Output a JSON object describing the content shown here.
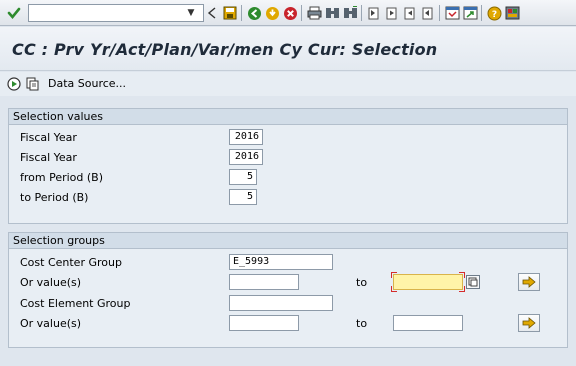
{
  "title": "CC : Prv Yr/Act/Plan/Var/men Cy Cur: Selection",
  "app_toolbar": {
    "data_source_label": "Data Source..."
  },
  "selection_values": {
    "header": "Selection values",
    "rows": [
      {
        "label": "Fiscal Year",
        "value": "2016"
      },
      {
        "label": "Fiscal Year",
        "value": "2016"
      },
      {
        "label": "from Period (B)",
        "value": "5"
      },
      {
        "label": "to Period (B)",
        "value": "5"
      }
    ]
  },
  "selection_groups": {
    "header": "Selection groups",
    "cost_center_group": {
      "label": "Cost Center Group",
      "value": "E_5993"
    },
    "cc_or_values": {
      "label": "Or value(s)",
      "from_value": "",
      "to_label": "to",
      "to_value": ""
    },
    "cost_element_group": {
      "label": "Cost Element Group",
      "value": ""
    },
    "ce_or_values": {
      "label": "Or value(s)",
      "from_value": "",
      "to_label": "to",
      "to_value": ""
    }
  },
  "colors": {
    "accent_green": "#2e8b2e",
    "save_yellow": "#e0a800",
    "cancel_red": "#c8242c",
    "focus_field": "#fff4a8"
  },
  "icons": [
    "enter-icon",
    "back-icon",
    "save-icon",
    "exit-icon",
    "cancel-icon",
    "print-icon",
    "find-icon",
    "find-next-icon",
    "first-page-icon",
    "previous-page-icon",
    "next-page-icon",
    "last-page-icon",
    "create-session-icon",
    "shortcut-icon",
    "help-icon",
    "layout-icon",
    "execute-icon",
    "get-variant-icon",
    "multiple-selection-icon"
  ]
}
